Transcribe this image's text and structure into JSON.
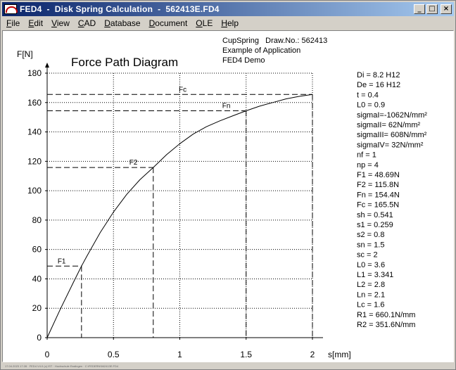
{
  "window": {
    "app_name": "FED4",
    "title": "FED4  -  Disk Spring Calculation  -  562413E.FD4",
    "controls": [
      "_",
      "□",
      "×"
    ]
  },
  "menu": {
    "items": [
      {
        "u": "F",
        "rest": "ile"
      },
      {
        "u": "E",
        "rest": "dit"
      },
      {
        "u": "V",
        "rest": "iew"
      },
      {
        "u": "C",
        "rest": "AD"
      },
      {
        "u": "D",
        "rest": "atabase"
      },
      {
        "u": "D",
        "rest": "ocument"
      },
      {
        "u": "O",
        "rest": "LE"
      },
      {
        "u": "H",
        "rest": "elp"
      }
    ]
  },
  "header": {
    "line1": "CupSpring   Draw.No.: 562413",
    "line2": "Example of Application",
    "line3": "FED4 Demo"
  },
  "parameters": [
    "Di = 8.2 H12",
    "De = 16 H12",
    "t = 0.4",
    "L0 = 0.9",
    "sigmaI=-1062N/mm²",
    "sigmaII=  62N/mm²",
    "sigmaIII= 608N/mm²",
    "sigmaIV=  32N/mm²",
    "nf =   1",
    "np =    4",
    "F1 = 48.69N",
    "F2 = 115.8N",
    "Fn = 154.4N",
    "Fc = 165.5N",
    "sh = 0.541",
    "s1 = 0.259",
    "s2 = 0.8",
    "sn = 1.5",
    "sc = 2",
    "L0 = 3.6",
    "L1 = 3.341",
    "L2 = 2.8",
    "Ln = 2.1",
    "Lc = 1.6",
    "R1 = 660.1N/mm",
    "R2 = 351.6N/mm"
  ],
  "statusbar": {
    "text": "17.04.2023 17:28 · FED4 V4.0 (c) IST · Hochschule Esslingen · C:\\FEDERN\\562413E.FD4"
  },
  "chart_data": {
    "type": "line",
    "title": "Force Path Diagram",
    "xlabel": "s[mm]",
    "ylabel": "F[N]",
    "xlim": [
      0,
      2
    ],
    "ylim": [
      0,
      180
    ],
    "xticks": [
      0,
      0.5,
      1,
      1.5,
      2
    ],
    "yticks": [
      0,
      20,
      40,
      60,
      80,
      100,
      120,
      140,
      160,
      180
    ],
    "grid": true,
    "series": [
      {
        "x": [
          0,
          0.1,
          0.2,
          0.259,
          0.3,
          0.4,
          0.5,
          0.6,
          0.7,
          0.8,
          0.9,
          1.0,
          1.1,
          1.2,
          1.3,
          1.4,
          1.5,
          1.6,
          1.7,
          1.8,
          1.9,
          2.0
        ],
        "y": [
          0,
          19.5,
          38.0,
          48.69,
          55.5,
          71.5,
          85.5,
          97.5,
          107.5,
          115.8,
          124.5,
          132.0,
          138.5,
          143.5,
          147.5,
          151.0,
          154.4,
          157.5,
          160.0,
          162.5,
          164.2,
          165.5
        ]
      }
    ],
    "markers": [
      {
        "label": "F1",
        "x": 0.259,
        "y": 48.69
      },
      {
        "label": "F2",
        "x": 0.8,
        "y": 115.8
      },
      {
        "label": "Fn",
        "x": 1.5,
        "y": 154.4
      },
      {
        "label": "Fc",
        "x": 2.0,
        "y": 165.5
      }
    ]
  }
}
